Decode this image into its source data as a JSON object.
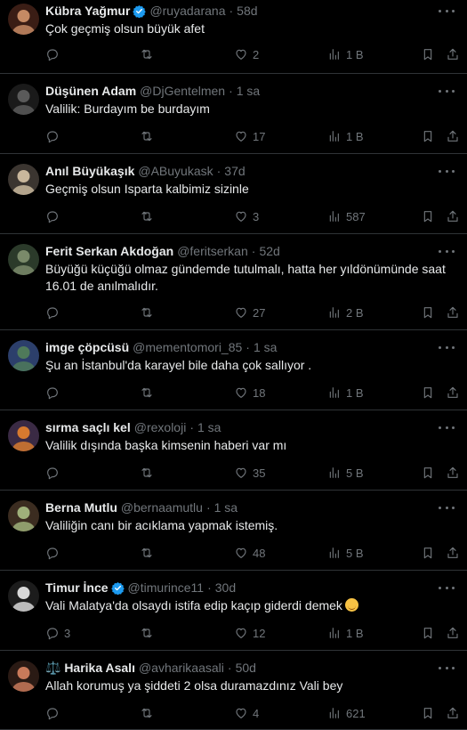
{
  "tweets": [
    {
      "name": "Kübra Yağmur",
      "verified": true,
      "handle": "@ruyadarana",
      "time": "58d",
      "text": "Çok geçmiş olsun büyük afet",
      "replies": "",
      "retweets": "",
      "likes": "2",
      "views": "1 B",
      "avatar_colors": [
        "#c58a64",
        "#3a1d15"
      ]
    },
    {
      "name": "Düşünen Adam",
      "verified": false,
      "handle": "@DjGentelmen",
      "time": "1 sa",
      "text": "Valilik: Burdayım be burdayım",
      "replies": "",
      "retweets": "",
      "likes": "17",
      "views": "1 B",
      "avatar_colors": [
        "#5a5a5a",
        "#1a1a1a"
      ]
    },
    {
      "name": "Anıl Büyükaşık",
      "verified": false,
      "handle": "@ABuyukask",
      "time": "37d",
      "text": "Geçmiş olsun Isparta kalbimiz sizinle",
      "replies": "",
      "retweets": "",
      "likes": "3",
      "views": "587",
      "avatar_colors": [
        "#c9b79c",
        "#3b3530"
      ]
    },
    {
      "name": "Ferit Serkan Akdoğan",
      "verified": false,
      "handle": "@feritserkan",
      "time": "52d",
      "text": "Büyüğü küçüğü olmaz gündemde tutulmalı, hatta her yıldönümünde saat 16.01 de anılmalıdır.",
      "replies": "",
      "retweets": "",
      "likes": "27",
      "views": "2 B",
      "avatar_colors": [
        "#7a8a6a",
        "#2b3a2a"
      ]
    },
    {
      "name": "imge çöpcüsü",
      "verified": false,
      "handle": "@mementomori_85",
      "time": "1 sa",
      "text": "Şu an İstanbul'da karayel bile daha çok sallıyor .",
      "replies": "",
      "retweets": "",
      "likes": "18",
      "views": "1 B",
      "avatar_colors": [
        "#4f7a5a",
        "#2c3f6b"
      ]
    },
    {
      "name": "sırma saçlı kel",
      "verified": false,
      "handle": "@rexoloji",
      "time": "1 sa",
      "text": "Valilik dışında başka kimsenin haberi var mı",
      "replies": "",
      "retweets": "",
      "likes": "35",
      "views": "5 B",
      "avatar_colors": [
        "#d77a2f",
        "#3a2a44"
      ]
    },
    {
      "name": "Berna Mutlu",
      "verified": false,
      "handle": "@bernaamutlu",
      "time": "1 sa",
      "text": "Valiliğin canı bir acıklama yapmak istemiş.",
      "replies": "",
      "retweets": "",
      "likes": "48",
      "views": "5 B",
      "avatar_colors": [
        "#9fb07a",
        "#3b2c20"
      ]
    },
    {
      "name": "Timur İnce",
      "verified": true,
      "handle": "@timurince11",
      "time": "30d",
      "text": "Vali Malatya'da olsaydı istifa edip kaçıp giderdi demek",
      "emoji": true,
      "replies": "3",
      "retweets": "",
      "likes": "12",
      "views": "1 B",
      "avatar_colors": [
        "#d8d8d8",
        "#1c1c1c"
      ]
    },
    {
      "name": "⚖️ Harika Asalı",
      "verified": false,
      "handle": "@avharikaasali",
      "time": "50d",
      "text": "Allah korumuş ya şiddeti 2 olsa duramazdınız Vali bey",
      "replies": "",
      "retweets": "",
      "likes": "4",
      "views": "621",
      "avatar_colors": [
        "#c97a5a",
        "#2a1a14"
      ]
    }
  ],
  "sep": "·",
  "icons": {
    "reply": "reply-icon",
    "retweet": "retweet-icon",
    "like": "heart-icon",
    "views": "views-icon",
    "bookmark": "bookmark-icon",
    "share": "share-icon",
    "more": "more-icon",
    "verified": "verified-badge-icon"
  },
  "colors": {
    "background": "#000000",
    "text": "#e7e9ea",
    "muted": "#71767b",
    "divider": "#2f3336",
    "verified": "#1d9bf0"
  }
}
